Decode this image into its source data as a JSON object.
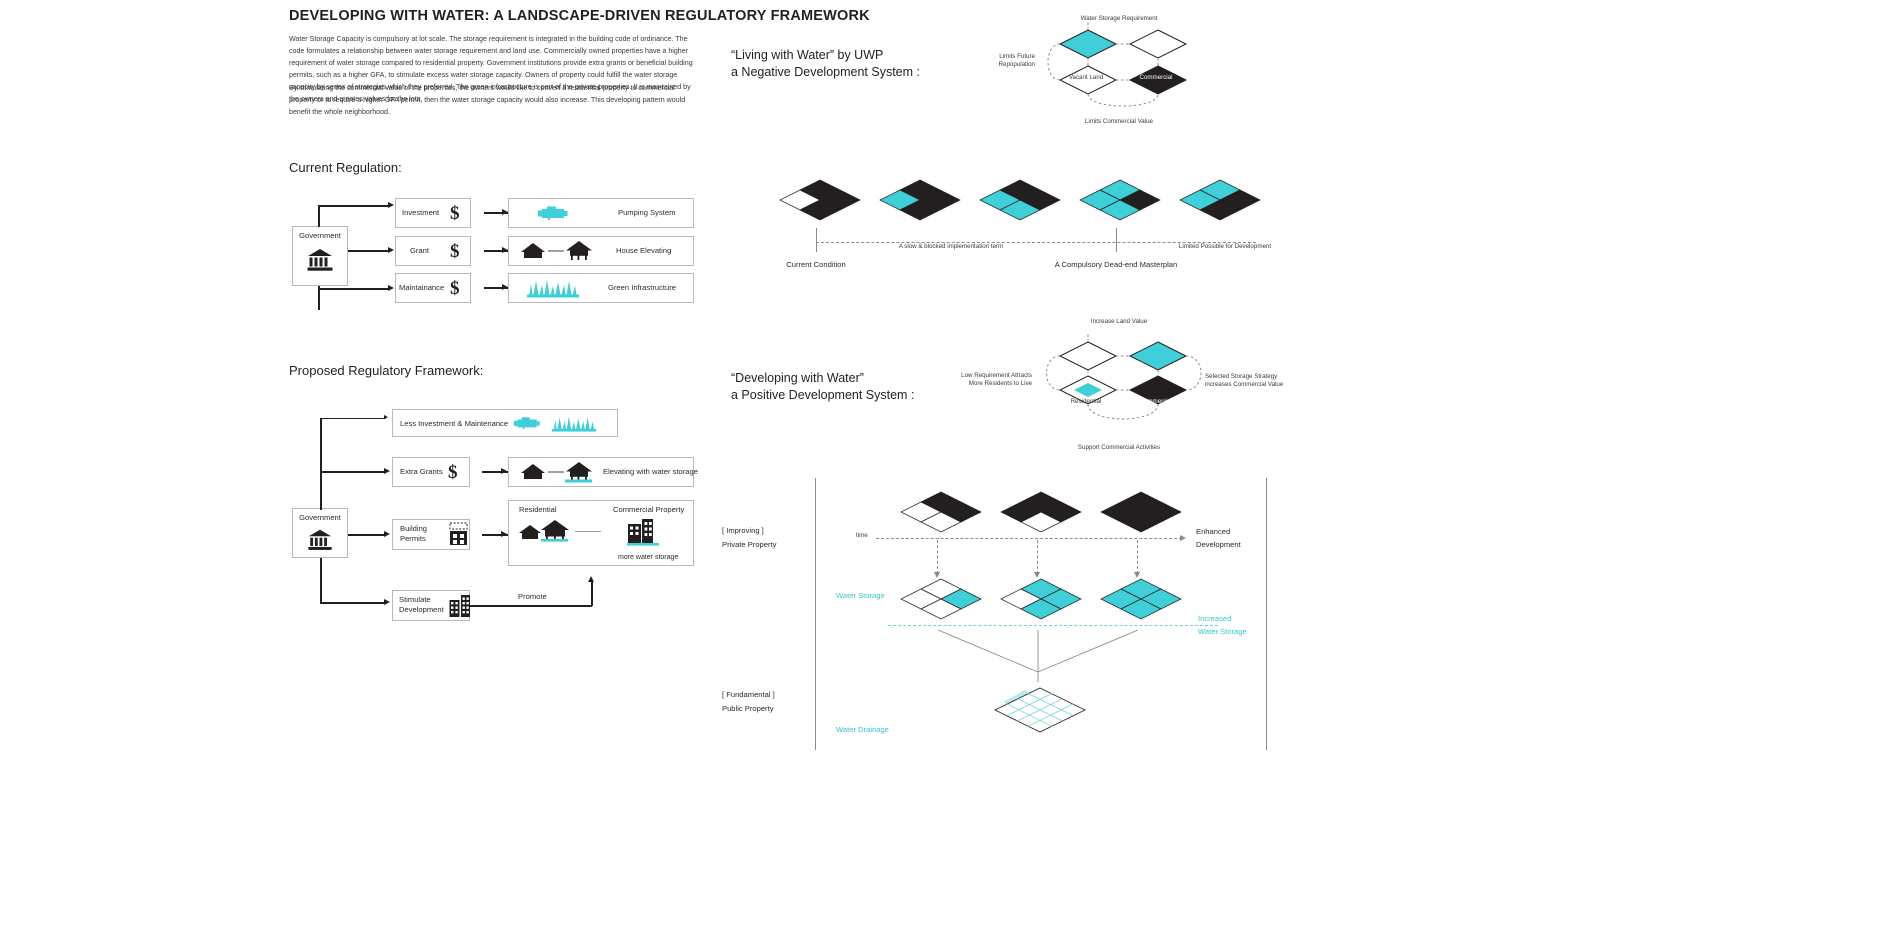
{
  "document": {
    "title": "DEVELOPING WITH WATER: A LANDSCAPE-DRIVEN REGULATORY FRAMEWORK",
    "intro_paragraph_1": "Water Storage Capacity is compulsory at lot scale. The storage requirement is integrated in the building code of ordinance. The code formulates a relationship between water storage requirement and land use.  Commercially owned properties have a higher requirement of water storage compared to residential property. Government institutions provide extra grants or beneficial building permits, such as a higher GFA, to stimulate excess water storage capacity. Owners of property could fulfill the water storage capacity by series of strategies which they preferred. The green infrastructure is part of the private properties. It is maintained by the owners and creates values for the lots.",
    "intro_paragraph_2": "By stimulating the commercial value of the properties, the owners would like to convert a residential property to commercial property or to require a higher GFA permit, then the water storage capacity would also increase. This developing pattern would benefit the whole neighborhood."
  },
  "colors": {
    "cyan": "#3fcfd8",
    "cyan_light": "#6fd3dc",
    "black": "#231f20",
    "box_border": "#b9b9b9",
    "grey_line": "#8a8a8a"
  },
  "current_regulation": {
    "heading": "Current Regulation:",
    "actor": {
      "label": "Government",
      "icon": "bank-icon"
    },
    "rows": [
      {
        "instrument": "Investment",
        "instrument_icon": "dollar-icon",
        "outcome": "Pumping System",
        "outcome_icon": "pump-icon"
      },
      {
        "instrument": "Grant",
        "instrument_icon": "dollar-icon",
        "outcome": "House Elevating",
        "outcome_icon": "house-elevating-icon"
      },
      {
        "instrument": "Maintainance",
        "instrument_icon": "dollar-icon",
        "outcome": "Green Infrastructure",
        "outcome_icon": "grass-icon"
      }
    ]
  },
  "proposed_framework": {
    "heading": "Proposed Regulatory Framework:",
    "actor": {
      "label": "Government",
      "icon": "bank-icon"
    },
    "rows": [
      {
        "instrument": "Less Investment & Maintenance",
        "instrument_icon": "pump-and-grass-icon",
        "outcome": "",
        "outcome_icon": ""
      },
      {
        "instrument": "Extra Grants",
        "instrument_icon": "dollar-icon",
        "outcome": "Elevating with water storage",
        "outcome_icon": "house-elevating-water-icon"
      },
      {
        "instrument": "Building\nPermits",
        "instrument_icon": "permit-building-icon",
        "outcome": "",
        "outcome_icon": ""
      },
      {
        "instrument": "Stimulate\nDevelopment",
        "instrument_icon": "city-icon",
        "outcome": "",
        "outcome_icon": ""
      }
    ],
    "permit_panel": {
      "left_label": "Residential",
      "right_label": "Commercial Property",
      "footnote": "more water storage"
    },
    "promote_label": "Promote"
  },
  "negative_system": {
    "title_line_1": "“Living with Water” by UWP",
    "title_line_2": "a Negative Development System :",
    "loop": {
      "top_label": "Water Storage Requirement",
      "left_label": "Limits Future\nRepopulation",
      "bottom_label": "Limits Commercial Value",
      "node_top": {
        "label": "",
        "fill": "cyan"
      },
      "node_left": {
        "label": "Vacant Land",
        "fill": "white"
      },
      "node_right_top": {
        "label": "",
        "fill": "white"
      },
      "node_right_bottom": {
        "label": "Commercial",
        "fill": "black"
      }
    },
    "timeline": {
      "stages": 5,
      "caption_left": "Current Condition",
      "caption_middle": "A slow & blocked implementation term",
      "caption_right_top": "Limited Possible for Development",
      "caption_right": "A Compulsory Dead-end Masterplan"
    }
  },
  "positive_system": {
    "title_line_1": "“Developing with Water”",
    "title_line_2": "a Positive Development System :",
    "loop": {
      "top_label": "Increase Land Value",
      "left_label": "Low Requirement Attracts\nMore Residents to Live",
      "right_label": "Selected Storage Strategy\nincreases Commercial Value",
      "bottom_label": "Support Commercial Activities",
      "node_left": {
        "label": "Residential",
        "fill": "white-cyan"
      },
      "node_right_top": {
        "label": "",
        "fill": "cyan"
      },
      "node_right_bottom": {
        "label": "Commercial",
        "fill": "black"
      }
    },
    "matrix": {
      "row_label_private_1": "[ Improving ]",
      "row_label_private_2": "Private Property",
      "row_label_public_1": "[ Fundamental ]",
      "row_label_public_2": "Public Property",
      "time_axis_label": "time",
      "water_storage_label": "Water Storage",
      "water_drainage_label": "Water Drainage",
      "enhanced_label_1": "Enhanced",
      "enhanced_label_2": "Development",
      "increased_label_1": "Increased",
      "increased_label_2": "Water Storage",
      "stages": 3
    }
  }
}
